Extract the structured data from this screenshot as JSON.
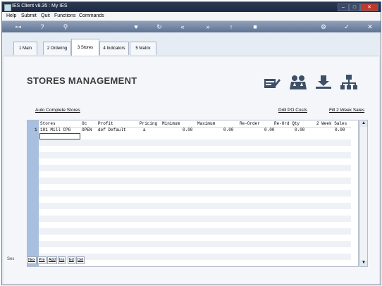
{
  "window": {
    "title": "IES Client v8.35 : My IES"
  },
  "menu": [
    "Help",
    "Submit",
    "Quit",
    "Functions",
    "Commands"
  ],
  "toolbar_icons": [
    "key-icon",
    "help-icon",
    "search-icon",
    "heart-icon",
    "refresh-icon",
    "rewind-icon",
    "fast-forward-icon",
    "up-icon",
    "stop-icon",
    "settings-icon",
    "check-icon",
    "close-icon"
  ],
  "tabs": [
    {
      "label": "1 Main",
      "active": false
    },
    {
      "label": "2 Ordering",
      "active": false
    },
    {
      "label": "3 Stores",
      "active": true
    },
    {
      "label": "4 Indicators",
      "active": false
    },
    {
      "label": "5 Matrix",
      "active": false
    }
  ],
  "page_title": "STORES MANAGEMENT",
  "links": {
    "auto_complete": "Auto Complete Stores",
    "drill_po": "Drill PO Costs",
    "fill_2week": "Fill 2 Week Sales"
  },
  "table": {
    "columns": [
      "Stores",
      "Oc",
      "Profit",
      "Pricing",
      "Minimum",
      "Maximum",
      "Re-Order",
      "Re-Ord Qty",
      "2 Week Sales"
    ],
    "rows": [
      {
        "num": "1",
        "cells": [
          "101 Mill CPG",
          "OPEN",
          "def Default",
          "a",
          "0.00",
          "0.00",
          "0.00",
          "0.00",
          "0.00"
        ]
      }
    ]
  },
  "bottom_buttons": [
    "Nex",
    "Pre",
    "Add",
    "Ins",
    "Ed",
    "Del"
  ],
  "side_label": "Ses"
}
